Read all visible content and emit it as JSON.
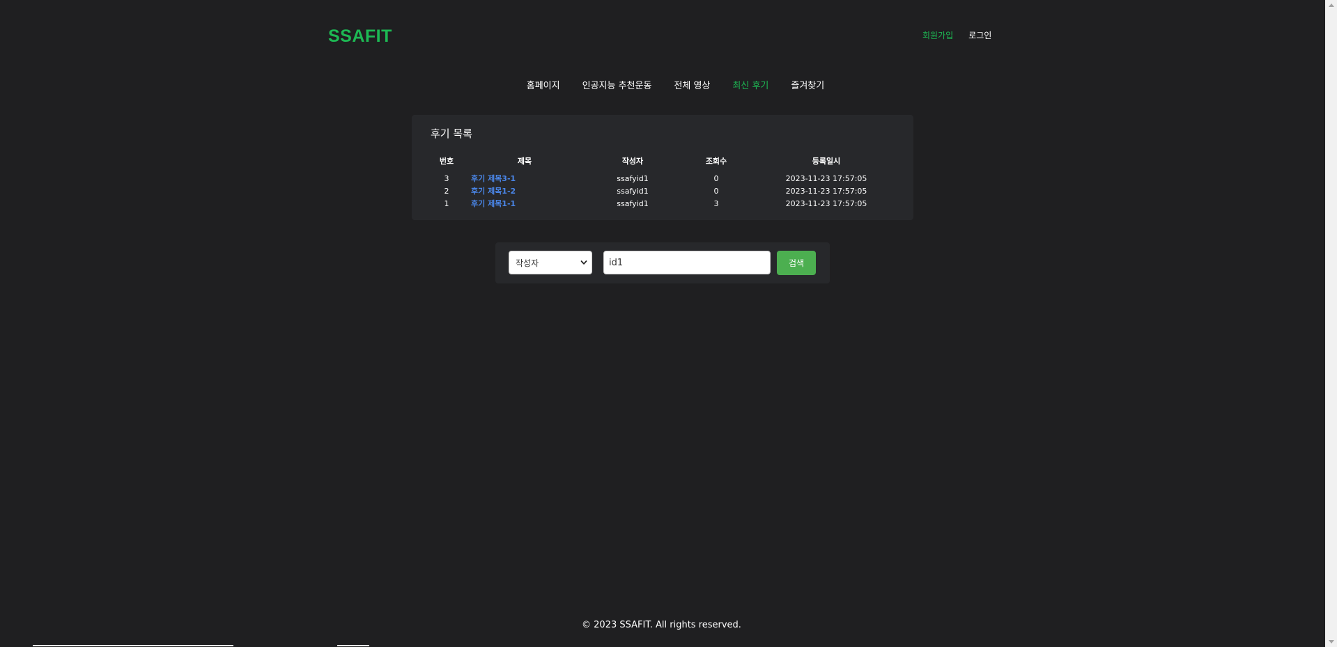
{
  "header": {
    "logo": "SSAFIT",
    "signup": "회원가입",
    "login": "로그인"
  },
  "nav": {
    "items": [
      "홈페이지",
      "인공지능 추천운동",
      "전체 영상",
      "최신 후기",
      "즐겨찾기"
    ],
    "active": "최신 후기"
  },
  "reviews": {
    "title": "후기 목록",
    "columns": [
      "번호",
      "제목",
      "작성자",
      "조회수",
      "등록일시"
    ],
    "rows": [
      {
        "no": "3",
        "title": "후기 제목3-1",
        "author": "ssafyid1",
        "views": "0",
        "date": "2023-11-23 17:57:05"
      },
      {
        "no": "2",
        "title": "후기 제목1-2",
        "author": "ssafyid1",
        "views": "0",
        "date": "2023-11-23 17:57:05"
      },
      {
        "no": "1",
        "title": "후기 제목1-1",
        "author": "ssafyid1",
        "views": "3",
        "date": "2023-11-23 17:57:05"
      }
    ]
  },
  "search": {
    "select_value": "작성자",
    "input_value": "id1",
    "button_label": "검색"
  },
  "footer": {
    "text": "© 2023 SSAFIT. All rights reserved."
  },
  "colors": {
    "background": "#1f1f21",
    "accent": "#1db954",
    "link": "#4a86e8",
    "button": "#4caf50"
  }
}
